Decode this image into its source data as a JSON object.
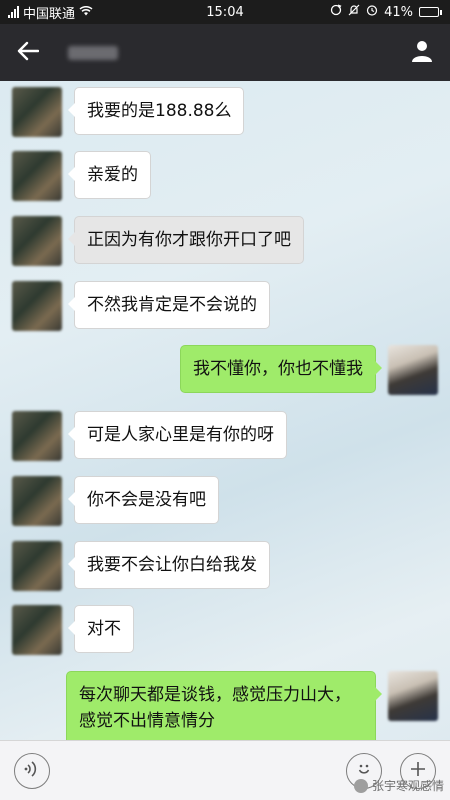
{
  "status_bar": {
    "carrier": "中国联通",
    "time": "15:04",
    "battery": "41%",
    "battery_level": 0.41
  },
  "header": {
    "contact_name": "",
    "back_icon": "back-arrow-icon",
    "profile_icon": "person-icon"
  },
  "messages": [
    {
      "side": "left",
      "text": "我要的是188.88么"
    },
    {
      "side": "left",
      "text": "亲爱的"
    },
    {
      "side": "left",
      "text": "正因为有你才跟你开口了吧"
    },
    {
      "side": "left",
      "text": "不然我肯定是不会说的"
    },
    {
      "side": "right",
      "text": "我不懂你，你也不懂我"
    },
    {
      "side": "left",
      "text": "可是人家心里是有你的呀"
    },
    {
      "side": "left",
      "text": "你不会是没有吧"
    },
    {
      "side": "left",
      "text": "我要不会让你白给我发"
    },
    {
      "side": "left",
      "text": "对不"
    },
    {
      "side": "right",
      "text": "每次聊天都是谈钱，感觉压力山大，感觉不出情意情分"
    }
  ],
  "input_bar": {
    "voice_icon": "voice-icon",
    "emoji_icon": "emoji-icon",
    "add_icon": "plus-icon"
  },
  "watermark": "张宇寒观感情"
}
